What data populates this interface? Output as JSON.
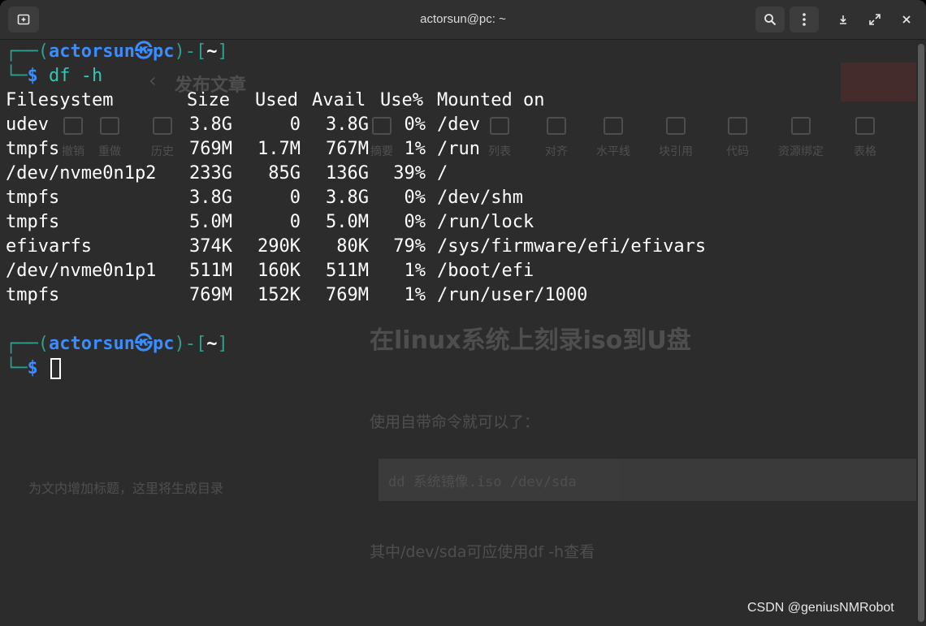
{
  "window": {
    "title": "actorsun@pc: ~"
  },
  "terminal": {
    "prompt1": {
      "user": "actorsun",
      "host": "pc",
      "dir": "~",
      "dollar": "$",
      "command": "df -h"
    },
    "headers": [
      "Filesystem",
      "Size",
      "Used",
      "Avail",
      "Use%",
      "Mounted on"
    ],
    "rows": [
      [
        "udev",
        "3.8G",
        "0",
        "3.8G",
        "0%",
        "/dev"
      ],
      [
        "tmpfs",
        "769M",
        "1.7M",
        "767M",
        "1%",
        "/run"
      ],
      [
        "/dev/nvme0n1p2",
        "233G",
        "85G",
        "136G",
        "39%",
        "/"
      ],
      [
        "tmpfs",
        "3.8G",
        "0",
        "3.8G",
        "0%",
        "/dev/shm"
      ],
      [
        "tmpfs",
        "5.0M",
        "0",
        "5.0M",
        "0%",
        "/run/lock"
      ],
      [
        "efivarfs",
        "374K",
        "290K",
        "80K",
        "79%",
        "/sys/firmware/efi/efivars"
      ],
      [
        "/dev/nvme0n1p1",
        "511M",
        "160K",
        "511M",
        "1%",
        "/boot/efi"
      ],
      [
        "tmpfs",
        "769M",
        "152K",
        "769M",
        "1%",
        "/run/user/1000"
      ]
    ],
    "prompt2": {
      "user": "actorsun",
      "host": "pc",
      "dir": "~",
      "dollar": "$"
    }
  },
  "background_page": {
    "publish_label": "发布文章",
    "toolbar": [
      "撤销",
      "重做",
      "历史",
      "摘要",
      "列表",
      "对齐",
      "水平线",
      "块引用",
      "代码",
      "资源绑定",
      "表格"
    ],
    "article_title": "在linux系统上刻录iso到U盘",
    "para1": "使用自带命令就可以了：",
    "code": "dd  系统镜像.iso  /dev/sda",
    "para2": "其中/dev/sda可应使用df -h查看",
    "toc_hint": "为文内增加标题，这里将生成目录"
  },
  "watermark": "CSDN @geniusNMRobot"
}
